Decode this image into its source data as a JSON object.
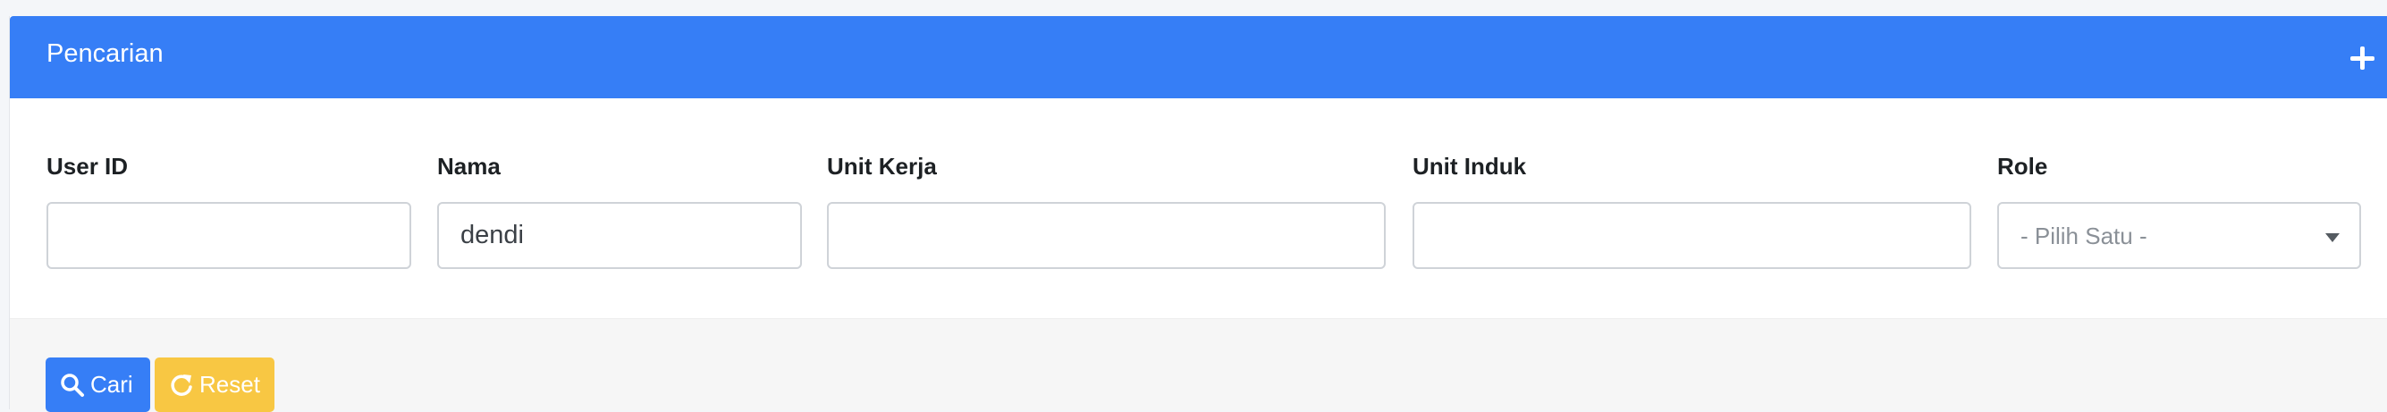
{
  "panel": {
    "title": "Pencarian",
    "expand_icon": "plus-icon"
  },
  "fields": {
    "user_id": {
      "label": "User ID",
      "value": ""
    },
    "nama": {
      "label": "Nama",
      "value": "dendi"
    },
    "unit_kerja": {
      "label": "Unit Kerja",
      "value": ""
    },
    "unit_induk": {
      "label": "Unit Induk",
      "value": ""
    },
    "role": {
      "label": "Role",
      "selected": "- Pilih Satu -"
    }
  },
  "actions": {
    "search_label": "Cari",
    "search_icon": "search-icon",
    "reset_label": "Reset",
    "reset_icon": "refresh-icon"
  },
  "colors": {
    "primary": "#367ef6",
    "warning": "#f8c743"
  }
}
